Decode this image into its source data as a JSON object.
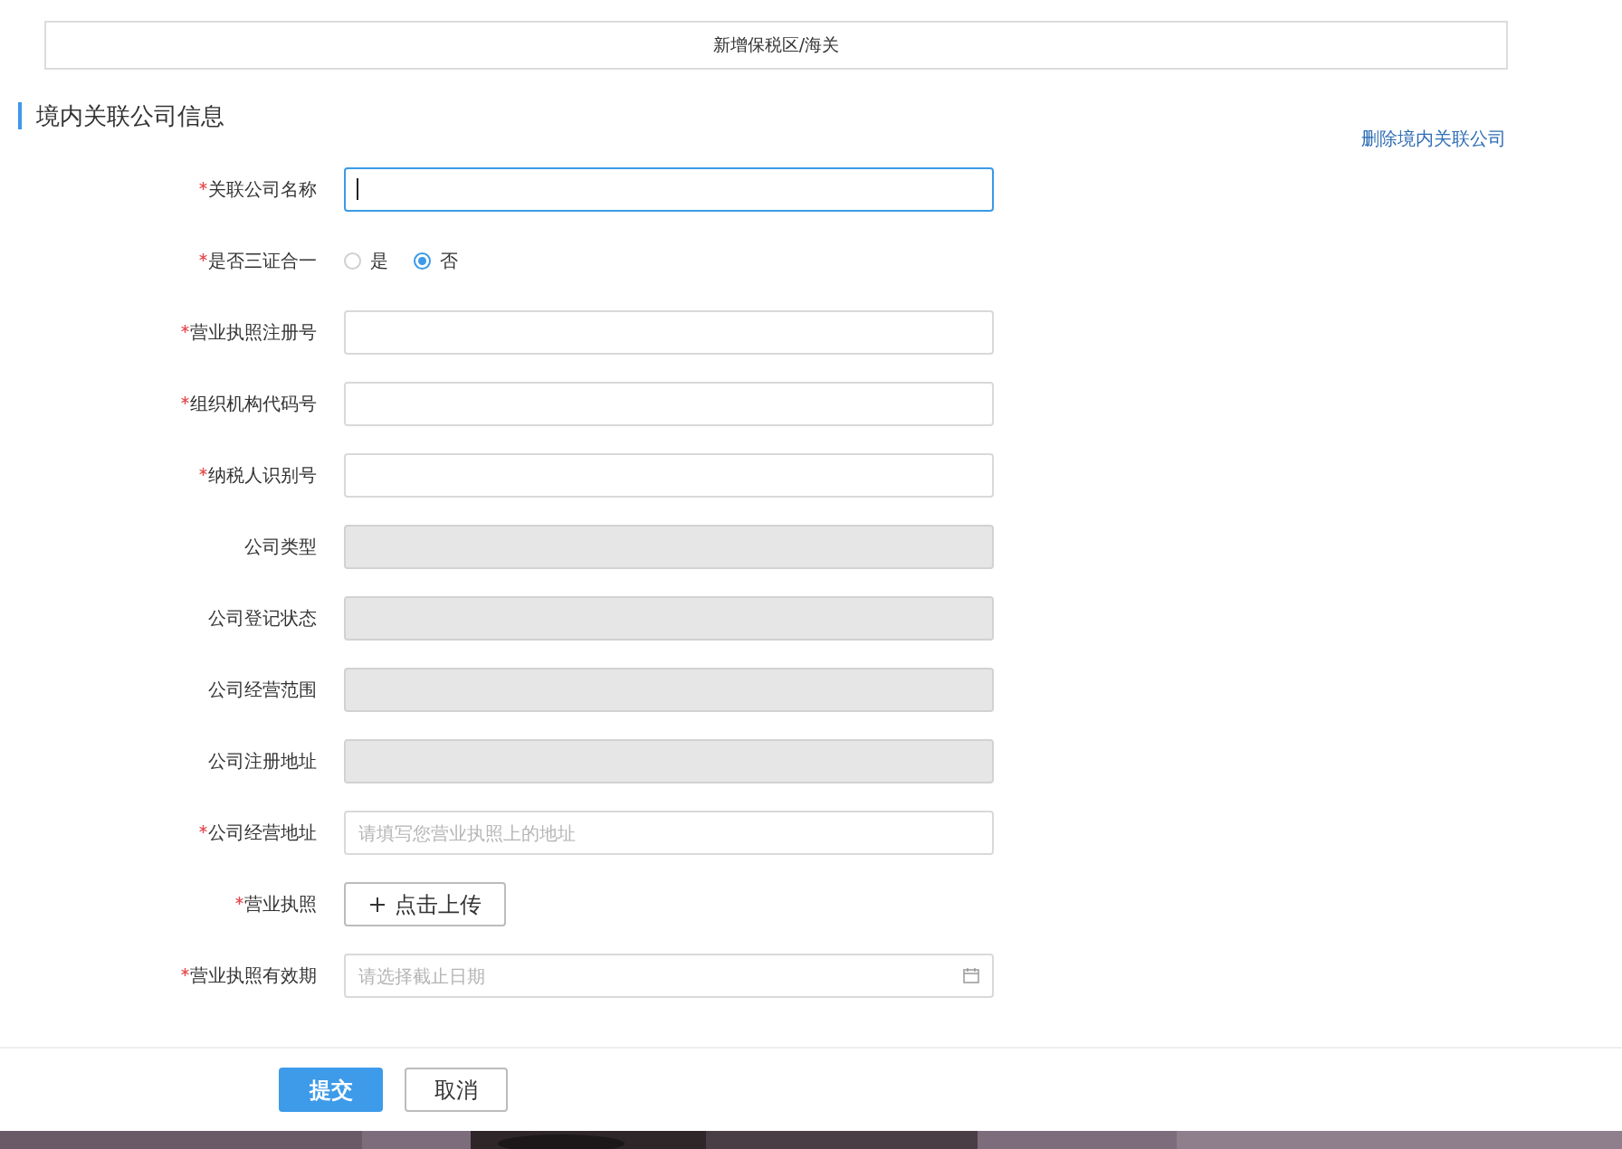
{
  "title_bar": {
    "title": "新增保税区/海关"
  },
  "section": {
    "title": "境内关联公司信息",
    "delete_link": "删除境内关联公司"
  },
  "fields": [
    {
      "kind": "text",
      "label": "关联公司名称",
      "required": true,
      "focused": true,
      "disabled": false
    },
    {
      "kind": "radio",
      "label": "是否三证合一",
      "required": true,
      "options": [
        {
          "label": "是",
          "selected": false
        },
        {
          "label": "否",
          "selected": true
        }
      ]
    },
    {
      "kind": "text",
      "label": "营业执照注册号",
      "required": true,
      "focused": false,
      "disabled": false
    },
    {
      "kind": "text",
      "label": "组织机构代码号",
      "required": true,
      "focused": false,
      "disabled": false
    },
    {
      "kind": "text",
      "label": "纳税人识别号",
      "required": true,
      "focused": false,
      "disabled": false
    },
    {
      "kind": "text",
      "label": "公司类型",
      "required": false,
      "focused": false,
      "disabled": true
    },
    {
      "kind": "text",
      "label": "公司登记状态",
      "required": false,
      "focused": false,
      "disabled": true
    },
    {
      "kind": "text",
      "label": "公司经营范围",
      "required": false,
      "focused": false,
      "disabled": true
    },
    {
      "kind": "text",
      "label": "公司注册地址",
      "required": false,
      "focused": false,
      "disabled": true
    },
    {
      "kind": "text",
      "label": "公司经营地址",
      "required": true,
      "focused": false,
      "disabled": false,
      "placeholder": "请填写您营业执照上的地址"
    },
    {
      "kind": "upload",
      "label": "营业执照",
      "required": true,
      "button": "点击上传"
    },
    {
      "kind": "date",
      "label": "营业执照有效期",
      "required": true,
      "placeholder": "请选择截止日期"
    }
  ],
  "footer": {
    "buttons": [
      {
        "label": "提交",
        "primary": true
      },
      {
        "label": "取消",
        "primary": false
      }
    ]
  }
}
